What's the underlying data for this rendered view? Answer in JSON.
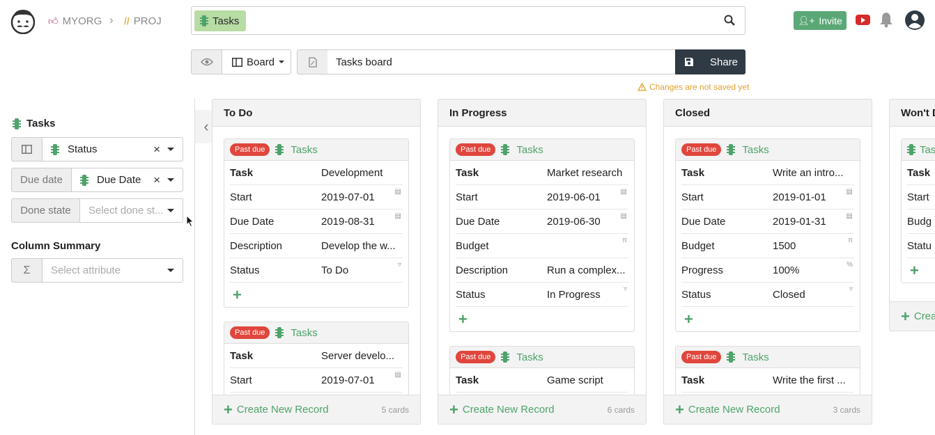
{
  "breadcrumb": {
    "org": "MYORG",
    "project": "PROJ"
  },
  "search": {
    "chip_label": "Tasks"
  },
  "header": {
    "invite_label": "Invite"
  },
  "toolbar": {
    "view_label": "Board",
    "title_value": "Tasks board",
    "save_label": "Share",
    "warning": "Changes are not saved yet"
  },
  "sidebar": {
    "title": "Tasks",
    "column_value": "Status",
    "due_label": "Due date",
    "due_value": "Due Date",
    "done_label": "Done state",
    "done_placeholder": "Select done st...",
    "summary_title": "Column Summary",
    "summary_placeholder": "Select attribute"
  },
  "common": {
    "past_due": "Past due",
    "collection": "Tasks",
    "create": "Create New Record",
    "create_short": "Crea"
  },
  "columns": [
    {
      "title": "To Do",
      "count": "5 cards",
      "cards": [
        {
          "rows": [
            [
              "Task",
              "Development"
            ],
            [
              "Start",
              "2019-07-01"
            ],
            [
              "Due Date",
              "2019-08-31"
            ],
            [
              "Description",
              "Develop the w..."
            ],
            [
              "Status",
              "To Do"
            ]
          ]
        },
        {
          "rows": [
            [
              "Task",
              "Server develo..."
            ],
            [
              "Start",
              "2019-07-01"
            ]
          ]
        }
      ]
    },
    {
      "title": "In Progress",
      "count": "6 cards",
      "cards": [
        {
          "rows": [
            [
              "Task",
              "Market research"
            ],
            [
              "Start",
              "2019-06-01"
            ],
            [
              "Due Date",
              "2019-06-30"
            ],
            [
              "Budget",
              ""
            ],
            [
              "Description",
              "Run a complex..."
            ],
            [
              "Status",
              "In Progress"
            ]
          ]
        },
        {
          "rows": [
            [
              "Task",
              "Game script"
            ]
          ]
        }
      ]
    },
    {
      "title": "Closed",
      "count": "3 cards",
      "cards": [
        {
          "rows": [
            [
              "Task",
              "Write an intro..."
            ],
            [
              "Start",
              "2019-01-01"
            ],
            [
              "Due Date",
              "2019-01-31"
            ],
            [
              "Budget",
              "1500"
            ],
            [
              "Progress",
              "100%"
            ],
            [
              "Status",
              "Closed"
            ]
          ]
        },
        {
          "rows": [
            [
              "Task",
              "Write the first ..."
            ]
          ]
        }
      ]
    },
    {
      "title": "Won't D",
      "cards": [
        {
          "rows": [
            [
              "Task",
              ""
            ],
            [
              "Start",
              ""
            ],
            [
              "Budg",
              ""
            ],
            [
              "Statu",
              ""
            ]
          ]
        }
      ]
    }
  ]
}
